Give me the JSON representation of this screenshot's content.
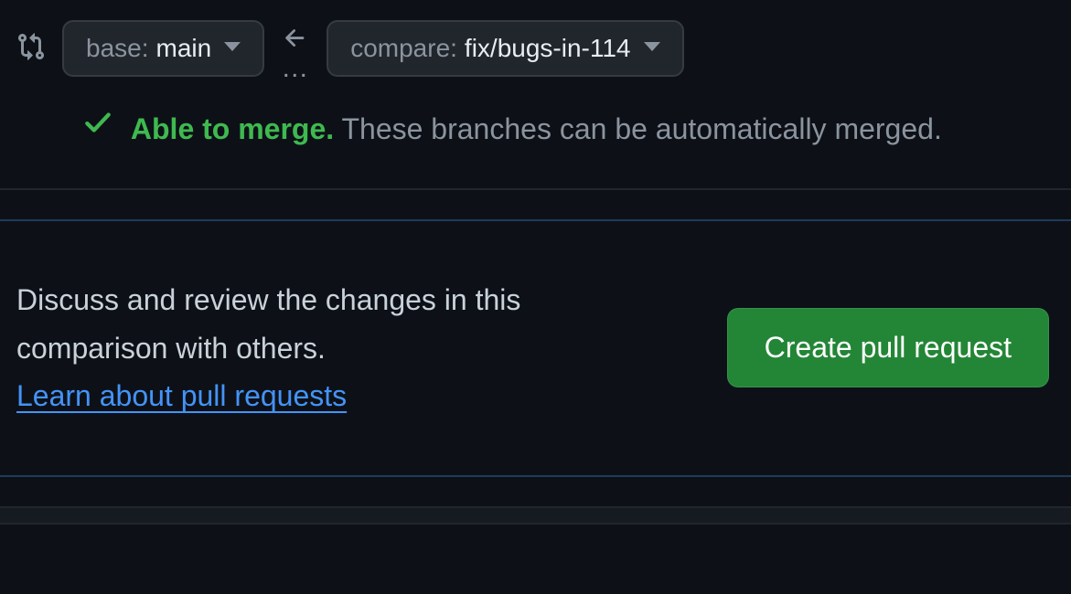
{
  "branches": {
    "base_prefix": "base:",
    "base_name": "main",
    "compare_prefix": "compare:",
    "compare_name": "fix/bugs-in-114"
  },
  "merge_status": {
    "title": "Able to merge.",
    "detail": "These branches can be automatically merged."
  },
  "panel": {
    "text": "Discuss and review the changes in this comparison with others.",
    "link_text": "Learn about pull requests",
    "button_label": "Create pull request"
  }
}
